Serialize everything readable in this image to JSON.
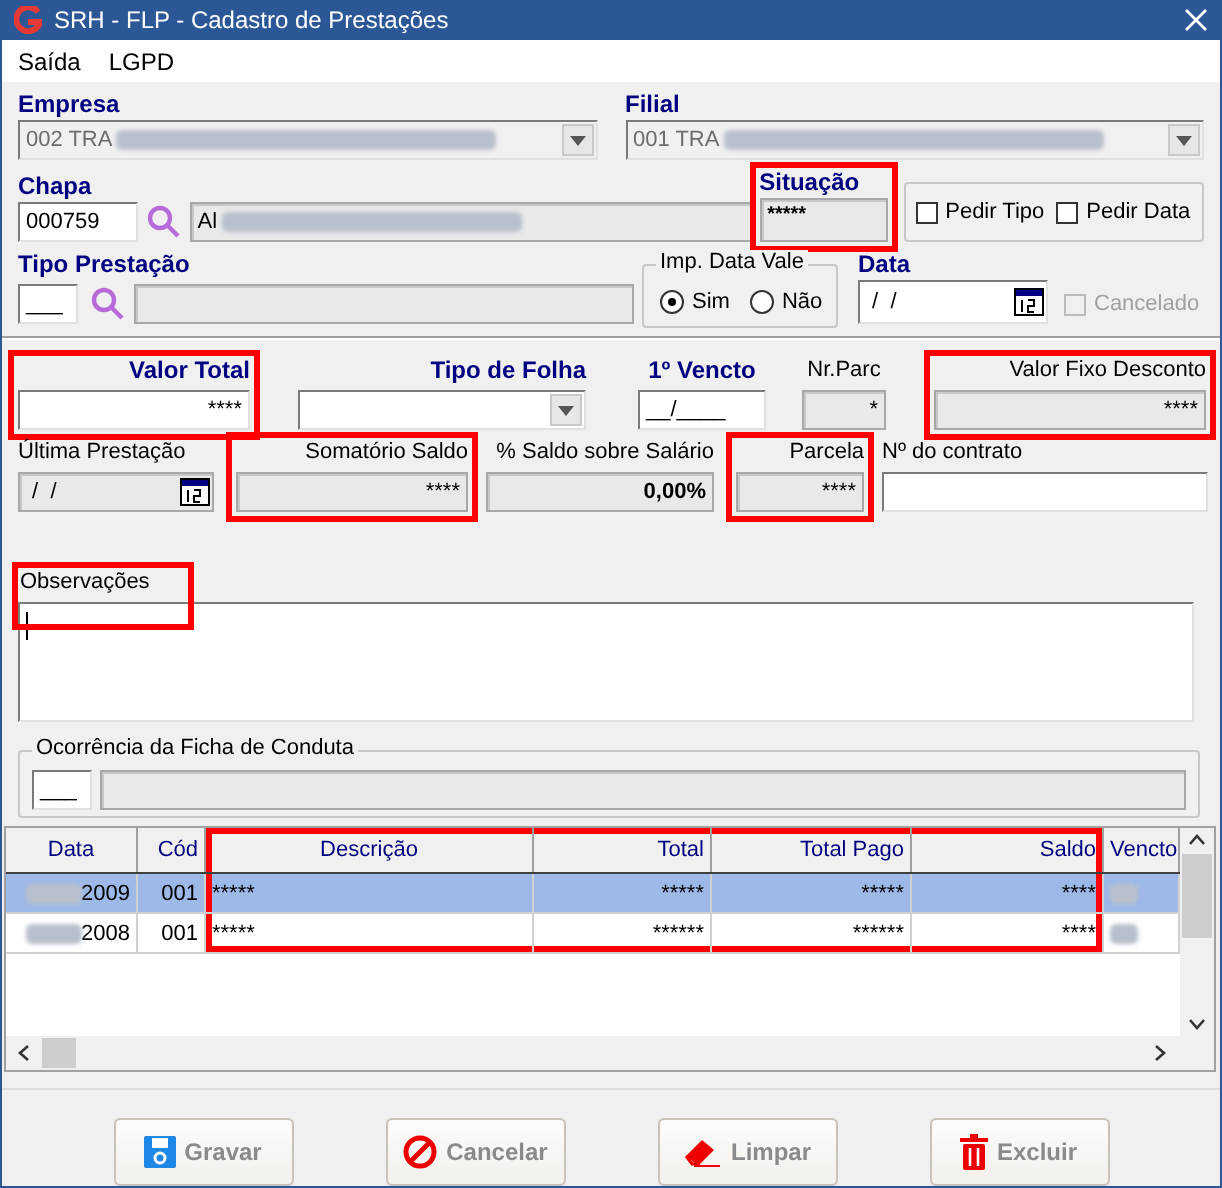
{
  "window": {
    "title": "SRH - FLP - Cadastro de Prestações"
  },
  "menu": [
    "Saída",
    "LGPD"
  ],
  "empresa": {
    "label": "Empresa",
    "value": "002 TRA",
    "disabled": true
  },
  "filial": {
    "label": "Filial",
    "value": "001 TRA",
    "disabled": true
  },
  "chapa": {
    "label": "Chapa",
    "value": "000759",
    "name": "Al"
  },
  "situacao": {
    "label": "Situação",
    "value": "*****",
    "highlighted": true
  },
  "options": [
    {
      "label": "Pedir Tipo",
      "checked": false
    },
    {
      "label": "Pedir Data",
      "checked": false
    }
  ],
  "tipo_prestacao": {
    "label": "Tipo Prestação",
    "value": "___"
  },
  "imp_data_vale": {
    "title": "Imp. Data Vale",
    "options": [
      {
        "label": "Sim",
        "selected": true
      },
      {
        "label": "Não",
        "selected": false
      }
    ]
  },
  "data": {
    "label": "Data",
    "value": " /  /"
  },
  "cancelado": {
    "label": "Cancelado",
    "checked": false,
    "disabled": true
  },
  "values_row": [
    {
      "label": "Valor Total",
      "value": "****",
      "kind": "text",
      "bold": true,
      "highlighted": true
    },
    {
      "label": "Tipo de Folha",
      "kind": "combo",
      "bold": true,
      "highlighted": false
    },
    {
      "label": "1º Vencto",
      "value": "__/____",
      "kind": "text",
      "bold": true,
      "highlighted": false
    },
    {
      "label": "Nr.Parc",
      "value": "*",
      "kind": "readonly",
      "bold": false,
      "highlighted": false
    },
    {
      "label": "Valor Fixo Desconto",
      "value": "****",
      "kind": "readonly",
      "bold": false,
      "highlighted": true
    }
  ],
  "totals_row": [
    {
      "label": "Última Prestação",
      "value": " /  /",
      "kind": "date",
      "bold": false,
      "highlighted": false
    },
    {
      "label": "Somatório Saldo",
      "value": "****",
      "kind": "readonly",
      "bold": false,
      "highlighted": true
    },
    {
      "label": "% Saldo sobre Salário",
      "value": "0,00%",
      "kind": "readonly",
      "bold": false,
      "highlighted": false
    },
    {
      "label": "Parcela",
      "value": "****",
      "kind": "readonly",
      "bold": false,
      "highlighted": true
    },
    {
      "label": "Nº do contrato",
      "kind": "text",
      "bold": false,
      "highlighted": false
    }
  ],
  "observacoes": {
    "label": "Observações",
    "highlighted": true
  },
  "ocorrencia": {
    "title": "Ocorrência da Ficha de Conduta",
    "code": "___"
  },
  "table": {
    "columns": [
      {
        "label": "Data",
        "highlighted": false
      },
      {
        "label": "Cód",
        "highlighted": false
      },
      {
        "label": "Descrição",
        "highlighted": true
      },
      {
        "label": "Total",
        "highlighted": true
      },
      {
        "label": "Total Pago",
        "highlighted": true
      },
      {
        "label": "Saldo",
        "highlighted": true
      },
      {
        "label": "Vencto",
        "highlighted": false
      }
    ],
    "rows": [
      {
        "selected": true,
        "cells": [
          "2009",
          "001",
          "*****",
          "*****",
          "*****",
          "****"
        ]
      },
      {
        "selected": false,
        "cells": [
          "2008",
          "001",
          "*****",
          "******",
          "******",
          "****"
        ]
      }
    ]
  },
  "buttons": [
    {
      "label": "Gravar",
      "disabled": true
    },
    {
      "label": "Cancelar",
      "disabled": true
    },
    {
      "label": "Limpar",
      "disabled": true
    },
    {
      "label": "Excluir",
      "disabled": true
    }
  ]
}
